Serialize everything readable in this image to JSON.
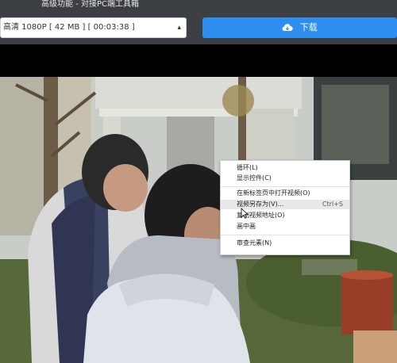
{
  "window": {
    "title": "高级功能 - 对接PC端工具箱"
  },
  "controls": {
    "quality_select": "高清 1080P [ 42 MB ] [ 00:03:38 ]",
    "download_label": "下载"
  },
  "context_menu": {
    "items": [
      {
        "label": "循环(L)",
        "shortcut": ""
      },
      {
        "label": "显示控件(C)",
        "shortcut": ""
      },
      {
        "label": "在新标签页中打开视频(O)",
        "shortcut": ""
      },
      {
        "label": "视频另存为(V)...",
        "shortcut": "Ctrl+S"
      },
      {
        "label": "复制视频地址(O)",
        "shortcut": ""
      },
      {
        "label": "画中画",
        "shortcut": ""
      },
      {
        "label": "审查元素(N)",
        "shortcut": ""
      }
    ]
  },
  "colors": {
    "accent": "#2d8ef0",
    "toolbar_bg": "#3c3f44"
  }
}
